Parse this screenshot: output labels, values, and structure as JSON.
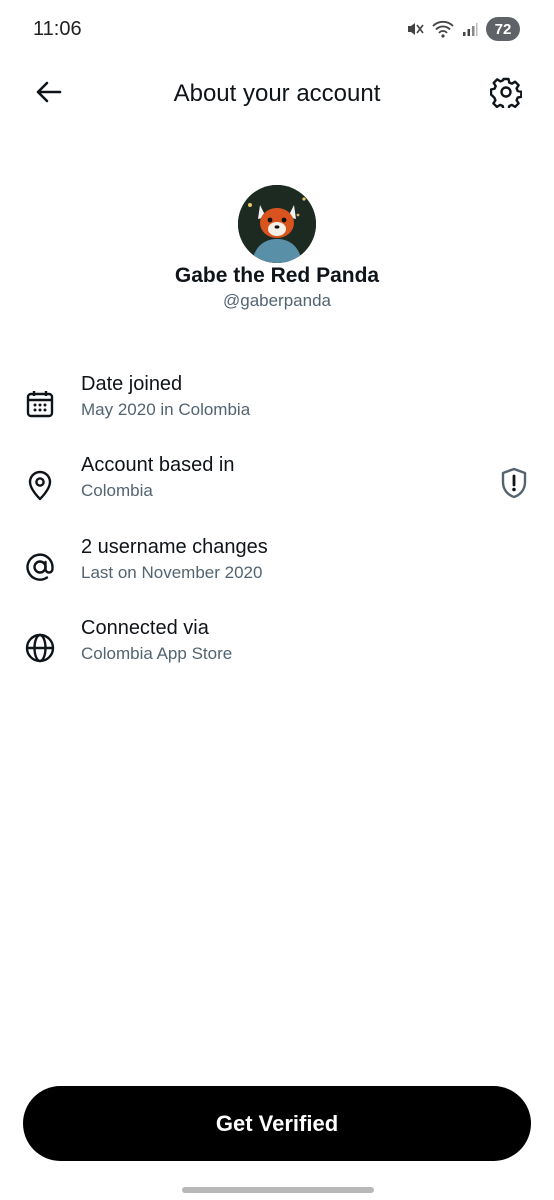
{
  "status_bar": {
    "time": "11:06",
    "battery": "72",
    "icons": [
      "muted-icon",
      "wifi-icon",
      "signal-icon"
    ]
  },
  "header": {
    "title": "About your account",
    "back_icon": "arrow-left-icon",
    "settings_icon": "gear-icon"
  },
  "profile": {
    "display_name": "Gabe the Red Panda",
    "handle": "@gaberpanda"
  },
  "info_items": [
    {
      "icon": "calendar-icon",
      "title": "Date joined",
      "subtitle": "May 2020 in Colombia"
    },
    {
      "icon": "location-pin-icon",
      "title": "Account based in",
      "subtitle": "Colombia",
      "trailing_icon": "shield-alert-icon"
    },
    {
      "icon": "at-sign-icon",
      "title": "2 username changes",
      "subtitle": "Last on November 2020"
    },
    {
      "icon": "globe-icon",
      "title": "Connected via",
      "subtitle": "Colombia App Store"
    }
  ],
  "footer": {
    "button_label": "Get Verified"
  },
  "colors": {
    "primary_text": "#0f1419",
    "secondary_text": "#536471",
    "button_bg": "#000000",
    "button_text": "#ffffff"
  }
}
